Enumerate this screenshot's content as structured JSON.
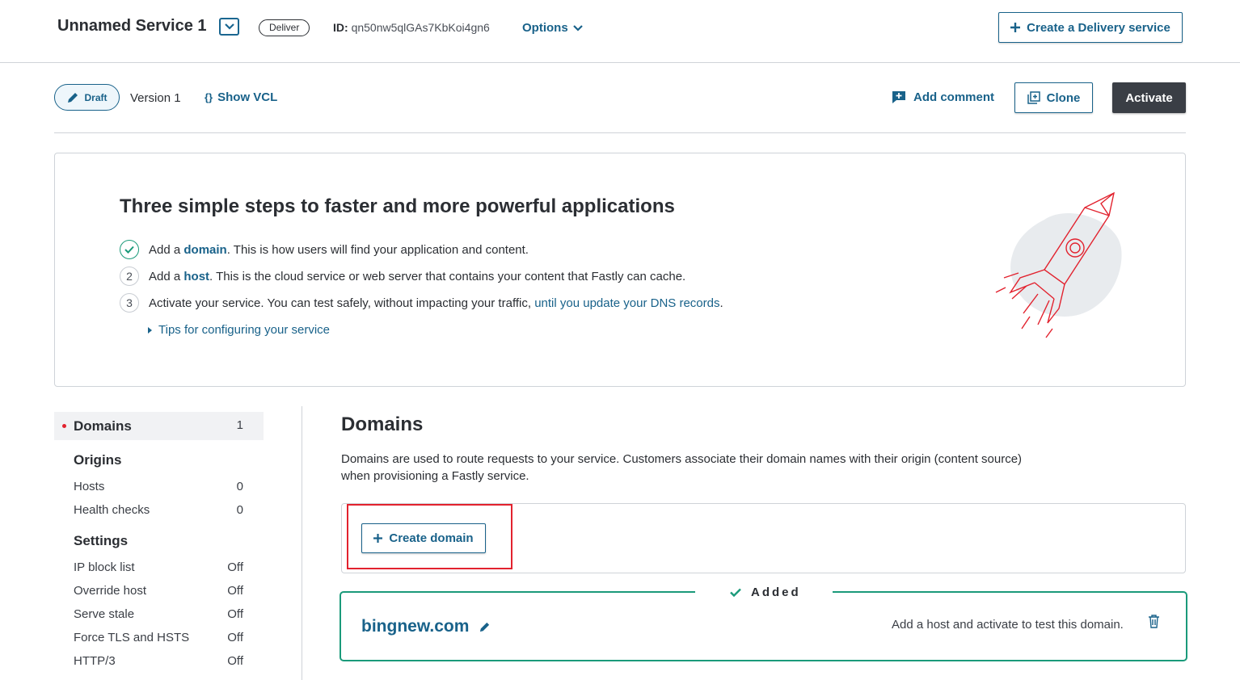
{
  "header": {
    "service_name": "Unnamed Service 1",
    "service_type_badge": "Deliver",
    "id_label": "ID:",
    "id_value": "qn50nw5qlGAs7KbKoi4gn6",
    "options_label": "Options",
    "create_delivery_label": "Create a Delivery service"
  },
  "version_bar": {
    "draft_label": "Draft",
    "version_label": "Version 1",
    "show_vcl_label": "Show VCL",
    "add_comment_label": "Add comment",
    "clone_label": "Clone",
    "activate_label": "Activate"
  },
  "steps": {
    "title": "Three simple steps to faster and more powerful applications",
    "items": [
      {
        "num": "",
        "done": true,
        "prefix": "Add a ",
        "link": "domain",
        "suffix": ". This is how users will find your application and content."
      },
      {
        "num": "2",
        "done": false,
        "prefix": "Add a ",
        "link": "host",
        "suffix": ". This is the cloud service or web server that contains your content that Fastly can cache."
      },
      {
        "num": "3",
        "done": false,
        "prefix": "Activate your service. You can test safely, without impacting your traffic, ",
        "link": "until you update your DNS records",
        "suffix": "."
      }
    ],
    "tips_label": "Tips for configuring your service"
  },
  "sidebar": {
    "domains": {
      "label": "Domains",
      "count": "1"
    },
    "origins_heading": "Origins",
    "origins": [
      {
        "label": "Hosts",
        "value": "0"
      },
      {
        "label": "Health checks",
        "value": "0"
      }
    ],
    "settings_heading": "Settings",
    "settings": [
      {
        "label": "IP block list",
        "value": "Off"
      },
      {
        "label": "Override host",
        "value": "Off"
      },
      {
        "label": "Serve stale",
        "value": "Off"
      },
      {
        "label": "Force TLS and HSTS",
        "value": "Off"
      },
      {
        "label": "HTTP/3",
        "value": "Off"
      }
    ]
  },
  "main": {
    "title": "Domains",
    "description": "Domains are used to route requests to your service. Customers associate their domain names with their origin (content source) when provisioning a Fastly service.",
    "create_domain_label": "Create domain",
    "added_label": "Added",
    "domain_name": "bingnew.com",
    "domain_note": "Add a host and activate to test this domain."
  },
  "colors": {
    "brand_blue": "#19628a",
    "accent_green": "#1a9a7a",
    "highlight_red": "#e2222e",
    "dark_button": "#3a3e45"
  }
}
